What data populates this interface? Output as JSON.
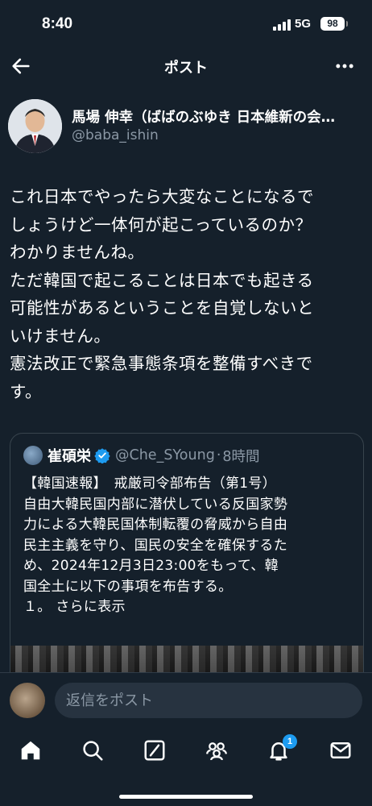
{
  "status_bar": {
    "time": "8:40",
    "network": "5G",
    "battery": "98"
  },
  "nav": {
    "title": "ポスト",
    "back_icon": "arrow-left-icon",
    "more_icon": "ellipsis-icon"
  },
  "author": {
    "name": "馬場 伸幸（ばばのぶゆき 日本維新の会…",
    "handle": "@baba_ishin"
  },
  "post": {
    "lines": [
      "これ日本でやったら大変なことになるで",
      "しょうけど一体何が起こっているのか？",
      "わかりませんね。",
      "ただ韓国で起こることは日本でも起きる",
      "可能性があるということを自覚しないと",
      "いけません。",
      "憲法改正で緊急事態条項を整備すべきで",
      "す。"
    ]
  },
  "quote": {
    "name": "崔碩栄",
    "handle": "@Che_SYoung",
    "separator": "·",
    "time": "8時間",
    "lines": [
      "【韓国速報】　戒厳司令部布告（第1号）",
      "自由大韓民国内部に潜伏している反国家勢",
      "力による大韓民国体制転覆の脅威から自由",
      "民主主義を守り、国民の安全を確保するた",
      "め、2024年12月3日23:00をもって、韓",
      "国全土に以下の事項を布告する。",
      "１。 さらに表示"
    ]
  },
  "reply": {
    "placeholder": "返信をポスト"
  },
  "tabs": {
    "items": [
      "home-icon",
      "search-icon",
      "grok-icon",
      "communities-icon",
      "notifications-icon",
      "messages-icon"
    ],
    "notification_badge": "1"
  },
  "colors": {
    "background": "#15202b",
    "secondary_text": "#8b98a5",
    "accent": "#1d9bf0",
    "border": "#38444d"
  }
}
